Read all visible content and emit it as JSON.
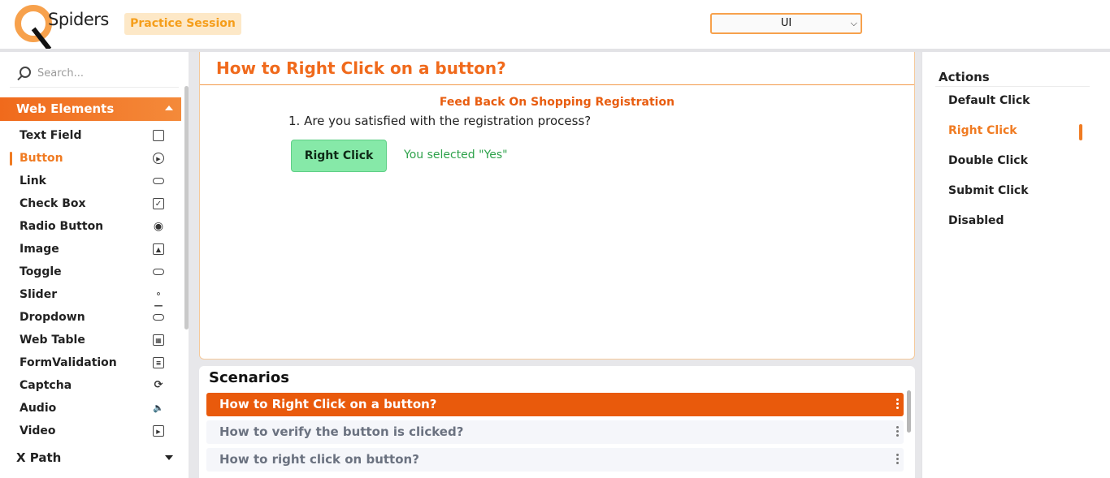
{
  "header": {
    "logo_text": "Spiders",
    "practice_label": "Practice Session",
    "selector_value": "UI"
  },
  "sidebar": {
    "search_placeholder": "Search...",
    "section_title": "Web Elements",
    "items": [
      {
        "label": "Text Field",
        "icon": "text-field-icon"
      },
      {
        "label": "Button",
        "icon": "play-circle-icon",
        "active": true
      },
      {
        "label": "Link",
        "icon": "link-icon"
      },
      {
        "label": "Check Box",
        "icon": "checkbox-icon"
      },
      {
        "label": "Radio Button",
        "icon": "radio-icon"
      },
      {
        "label": "Image",
        "icon": "image-icon"
      },
      {
        "label": "Toggle",
        "icon": "toggle-icon"
      },
      {
        "label": "Slider",
        "icon": "slider-icon"
      },
      {
        "label": "Dropdown",
        "icon": "dropdown-icon"
      },
      {
        "label": "Web Table",
        "icon": "table-icon"
      },
      {
        "label": "FormValidation",
        "icon": "form-icon"
      },
      {
        "label": "Captcha",
        "icon": "captcha-icon"
      },
      {
        "label": "Audio",
        "icon": "audio-icon"
      },
      {
        "label": "Video",
        "icon": "video-icon"
      }
    ],
    "xpath_label": "X Path"
  },
  "main": {
    "title": "How to Right Click on a button?",
    "feedback_title": "Feed Back On Shopping Registration",
    "question": "1. Are you satisfied with the registration process?",
    "button_label": "Right Click",
    "selected_message": "You selected \"Yes\""
  },
  "scenarios": {
    "title": "Scenarios",
    "items": [
      {
        "label": "How to Right Click on a button?",
        "active": true
      },
      {
        "label": "How to verify the button is clicked?"
      },
      {
        "label": "How to right click on button?"
      }
    ]
  },
  "actions": {
    "title": "Actions",
    "items": [
      {
        "label": "Default Click"
      },
      {
        "label": "Right Click",
        "active": true
      },
      {
        "label": "Double Click"
      },
      {
        "label": "Submit Click"
      },
      {
        "label": "Disabled"
      }
    ]
  },
  "colors": {
    "accent": "#f06a1c",
    "success": "#2ea24b",
    "button_green": "#86e9a8"
  }
}
